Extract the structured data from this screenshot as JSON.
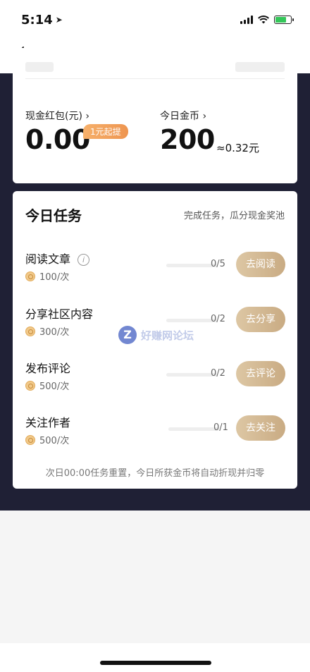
{
  "status_bar": {
    "time": "5:14"
  },
  "wallet": {
    "cash_label": "现金红包(元)",
    "cash_value": "0.00",
    "withdraw_badge": "1元起提",
    "coins_label": "今日金币",
    "coins_value": "200",
    "coins_approx": "≈0.32元"
  },
  "tasks": {
    "title": "今日任务",
    "subtitle": "完成任务，瓜分现金奖池",
    "items": [
      {
        "name": "阅读文章",
        "reward": "100/次",
        "progress_text": "0/5",
        "progress_fraction": 0,
        "button": "去阅读"
      },
      {
        "name": "分享社区内容",
        "reward": "300/次",
        "progress_text": "0/2",
        "progress_fraction": 0,
        "button": "去分享"
      },
      {
        "name": "发布评论",
        "reward": "500/次",
        "progress_text": "0/2",
        "progress_fraction": 0,
        "button": "去评论"
      },
      {
        "name": "关注作者",
        "reward": "500/次",
        "progress_text": "0/1",
        "progress_fraction": 0,
        "button": "去关注"
      }
    ],
    "footer_note": "次日00:00任务重置，今日所获金币将自动折现并归零"
  },
  "watermark": {
    "text": "好赚网论坛",
    "logo_letter": "Z"
  },
  "icons": {
    "back": "chevron-left-icon",
    "info": "info-circle-icon",
    "coin": "coin-icon"
  },
  "colors": {
    "dark_band": "#1f2035",
    "badge": "#ee9550",
    "task_button": "#c9ab83"
  }
}
